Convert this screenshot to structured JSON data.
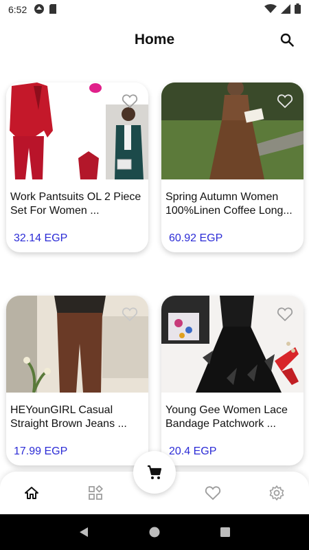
{
  "status_bar": {
    "time": "6:52"
  },
  "header": {
    "title": "Home"
  },
  "products": [
    {
      "title": "Work Pantsuits OL 2 Piece Set For Women ...",
      "price": "32.14 EGP"
    },
    {
      "title": "Spring Autumn Women 100%Linen Coffee Long...",
      "price": "60.92 EGP"
    },
    {
      "title": "HEYounGIRL Casual Straight Brown Jeans ...",
      "price": "17.99 EGP"
    },
    {
      "title": "Young Gee Women Lace Bandage Patchwork ...",
      "price": "20.4 EGP"
    }
  ],
  "colors": {
    "price": "#2b2bd6",
    "icon": "#9e9e9e"
  },
  "bottom_nav": {
    "items": [
      "home-icon",
      "categories-icon",
      "cart-icon",
      "favorites-icon",
      "settings-icon"
    ],
    "active": "home-icon"
  }
}
